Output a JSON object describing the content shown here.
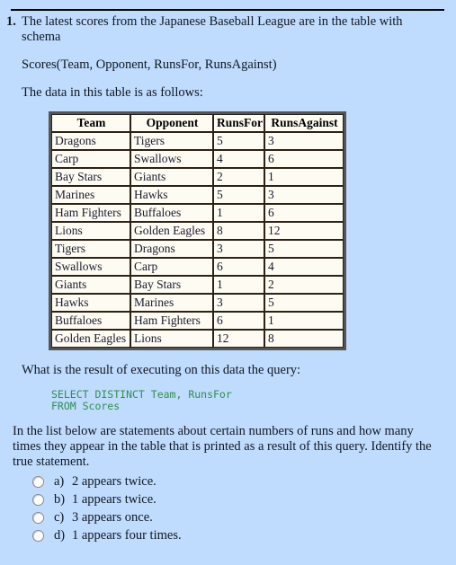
{
  "question": {
    "number": "1.",
    "stem": "The latest scores from the Japanese Baseball League are in the table with schema",
    "schema": "Scores(Team, Opponent, RunsFor, RunsAgainst)",
    "data_intro": "The data in this table is as follows:",
    "query_intro": "What is the result of executing on this data the query:",
    "sql": "SELECT DISTINCT Team, RunsFor\nFROM Scores",
    "list_intro": "In the list below are statements about certain numbers of runs and how many times they appear in the table that is printed as a result of this query. Identify the true statement."
  },
  "table": {
    "headers": [
      "Team",
      "Opponent",
      "RunsFor",
      "RunsAgainst"
    ],
    "rows": [
      [
        "Dragons",
        "Tigers",
        "5",
        "3"
      ],
      [
        "Carp",
        "Swallows",
        "4",
        "6"
      ],
      [
        "Bay Stars",
        "Giants",
        "2",
        "1"
      ],
      [
        "Marines",
        "Hawks",
        "5",
        "3"
      ],
      [
        "Ham Fighters",
        "Buffaloes",
        "1",
        "6"
      ],
      [
        "Lions",
        "Golden Eagles",
        "8",
        "12"
      ],
      [
        "Tigers",
        "Dragons",
        "3",
        "5"
      ],
      [
        "Swallows",
        "Carp",
        "6",
        "4"
      ],
      [
        "Giants",
        "Bay Stars",
        "1",
        "2"
      ],
      [
        "Hawks",
        "Marines",
        "3",
        "5"
      ],
      [
        "Buffaloes",
        "Ham Fighters",
        "6",
        "1"
      ],
      [
        "Golden Eagles",
        "Lions",
        "12",
        "8"
      ]
    ]
  },
  "options": [
    {
      "letter": "a)",
      "text": "2 appears twice."
    },
    {
      "letter": "b)",
      "text": "1 appears twice."
    },
    {
      "letter": "c)",
      "text": "3 appears once."
    },
    {
      "letter": "d)",
      "text": "1 appears four times."
    }
  ],
  "colors": {
    "page_background": "#bfdbfd",
    "table_cell_background": "#fdfbf2",
    "table_outer_border": "#555555",
    "table_cell_border": "#2b2117",
    "sql_text": "#2f8f4f",
    "body_text": "#101820"
  }
}
